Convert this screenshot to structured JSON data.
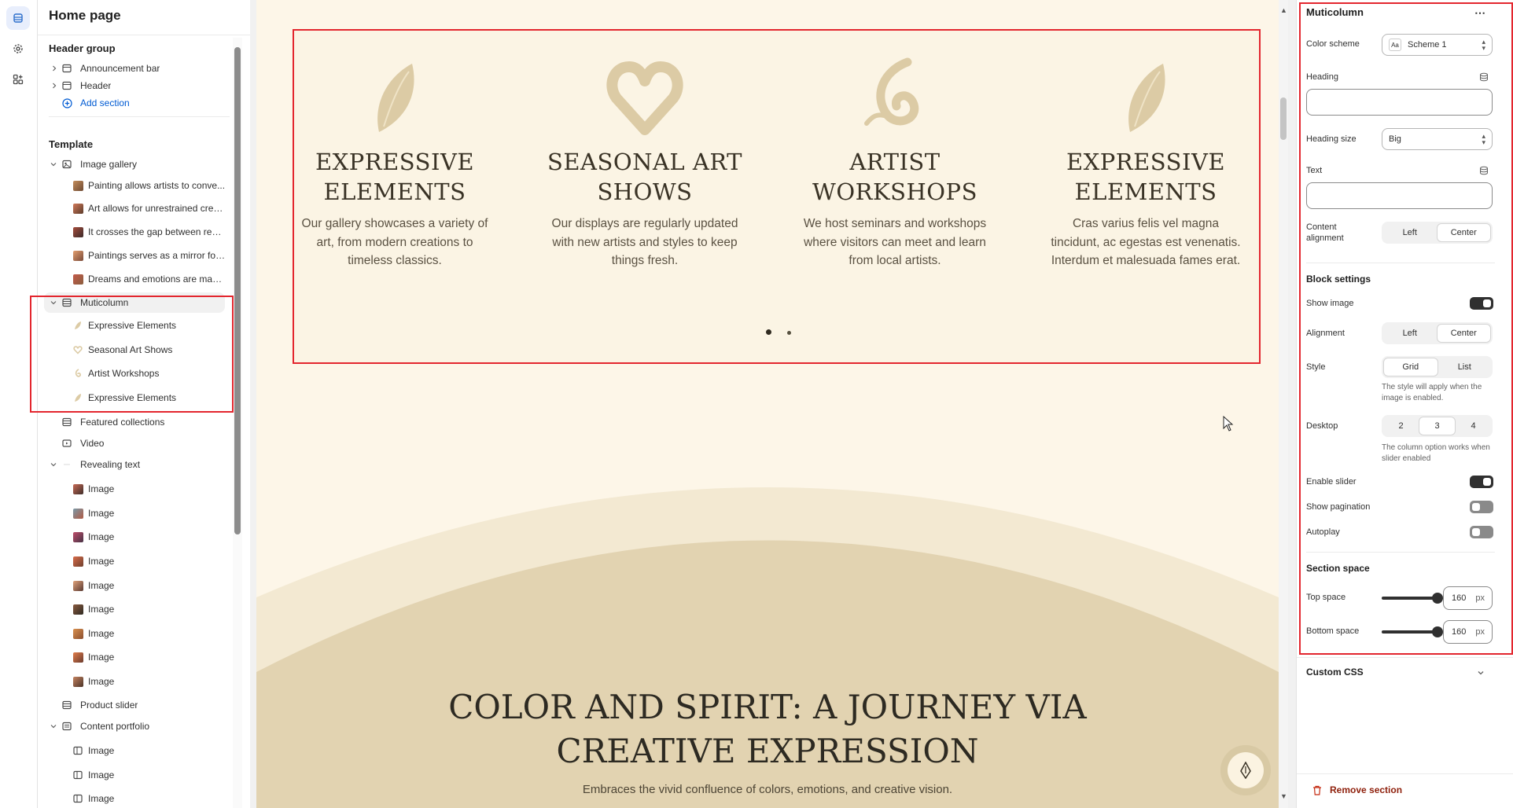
{
  "sidebar": {
    "title": "Home page",
    "header_group": {
      "title": "Header group",
      "items": [
        "Announcement bar",
        "Header"
      ],
      "add_section": "Add section"
    },
    "template": {
      "title": "Template",
      "image_gallery": {
        "label": "Image gallery",
        "children": [
          "Painting allows artists to conve...",
          "Art allows for unrestrained crea...",
          "It crosses the gap between reali...",
          "Paintings serves as a mirror for ...",
          "Dreams and emotions are made..."
        ]
      },
      "multicolumn": {
        "label": "Muticolumn",
        "children": [
          "Expressive Elements",
          "Seasonal Art Shows",
          "Artist Workshops",
          "Expressive Elements"
        ]
      },
      "featured_collections": "Featured collections",
      "video": "Video",
      "revealing_text": {
        "label": "Revealing text",
        "children": [
          "Image",
          "Image",
          "Image",
          "Image",
          "Image",
          "Image",
          "Image",
          "Image",
          "Image"
        ]
      },
      "product_slider": "Product slider",
      "content_portfolio": {
        "label": "Content portfolio",
        "children": [
          "Image",
          "Image",
          "Image"
        ]
      }
    }
  },
  "preview": {
    "columns": [
      {
        "icon": "leaf-brush-icon",
        "title": "EXPRESSIVE ELEMENTS",
        "text": "Our gallery showcases a variety of art, from modern creations to timeless classics."
      },
      {
        "icon": "heart-brush-icon",
        "title": "SEASONAL ART SHOWS",
        "text": "Our displays are regularly updated with new artists and styles to keep things fresh."
      },
      {
        "icon": "swirl-brush-icon",
        "title": "ARTIST WORKSHOPS",
        "text": "We host seminars and workshops where visitors can meet and learn from local artists."
      },
      {
        "icon": "leaf-brush-icon",
        "title": "EXPRESSIVE ELEMENTS",
        "text": "Cras varius felis vel magna tincidunt, ac egestas est venenatis. Interdum et malesuada fames erat."
      }
    ],
    "pagination_pages": 2,
    "pagination_active": 1,
    "journey_title_line1": "COLOR AND SPIRIT: A JOURNEY VIA",
    "journey_title_line2": "CREATIVE EXPRESSION",
    "journey_subtitle": "Embraces the vivid confluence of colors, emotions, and creative vision."
  },
  "settings": {
    "title": "Muticolumn",
    "color_scheme_label": "Color scheme",
    "color_scheme_value": "Scheme 1",
    "color_scheme_swatch_text": "Aa",
    "heading_label": "Heading",
    "heading_value": "",
    "heading_size_label": "Heading size",
    "heading_size_value": "Big",
    "text_label": "Text",
    "text_value": "",
    "content_alignment_label": "Content alignment",
    "content_alignment_options": [
      "Left",
      "Center"
    ],
    "content_alignment_selected": "Center",
    "block_settings_title": "Block settings",
    "show_image_label": "Show image",
    "show_image_on": true,
    "alignment_label": "Alignment",
    "alignment_options": [
      "Left",
      "Center"
    ],
    "alignment_selected": "Center",
    "style_label": "Style",
    "style_options": [
      "Grid",
      "List"
    ],
    "style_selected": "Grid",
    "style_hint": "The style will apply when the image is enabled.",
    "desktop_label": "Desktop",
    "desktop_options": [
      "2",
      "3",
      "4"
    ],
    "desktop_selected": "3",
    "desktop_hint": "The column option works when slider enabled",
    "enable_slider_label": "Enable slider",
    "enable_slider_on": true,
    "show_pagination_label": "Show pagination",
    "show_pagination_on": false,
    "autoplay_label": "Autoplay",
    "autoplay_on": false,
    "section_space_title": "Section space",
    "top_space_label": "Top space",
    "top_space_value": "160",
    "bottom_space_label": "Bottom space",
    "bottom_space_value": "160",
    "unit": "px",
    "custom_css_label": "Custom CSS",
    "remove_section_label": "Remove section"
  },
  "colors": {
    "highlight_red": "#e3262e",
    "preview_bg": "#fdf6e8",
    "brush_tan": "#dccba5",
    "link_blue": "#005bd3",
    "danger": "#8e1f0b"
  }
}
